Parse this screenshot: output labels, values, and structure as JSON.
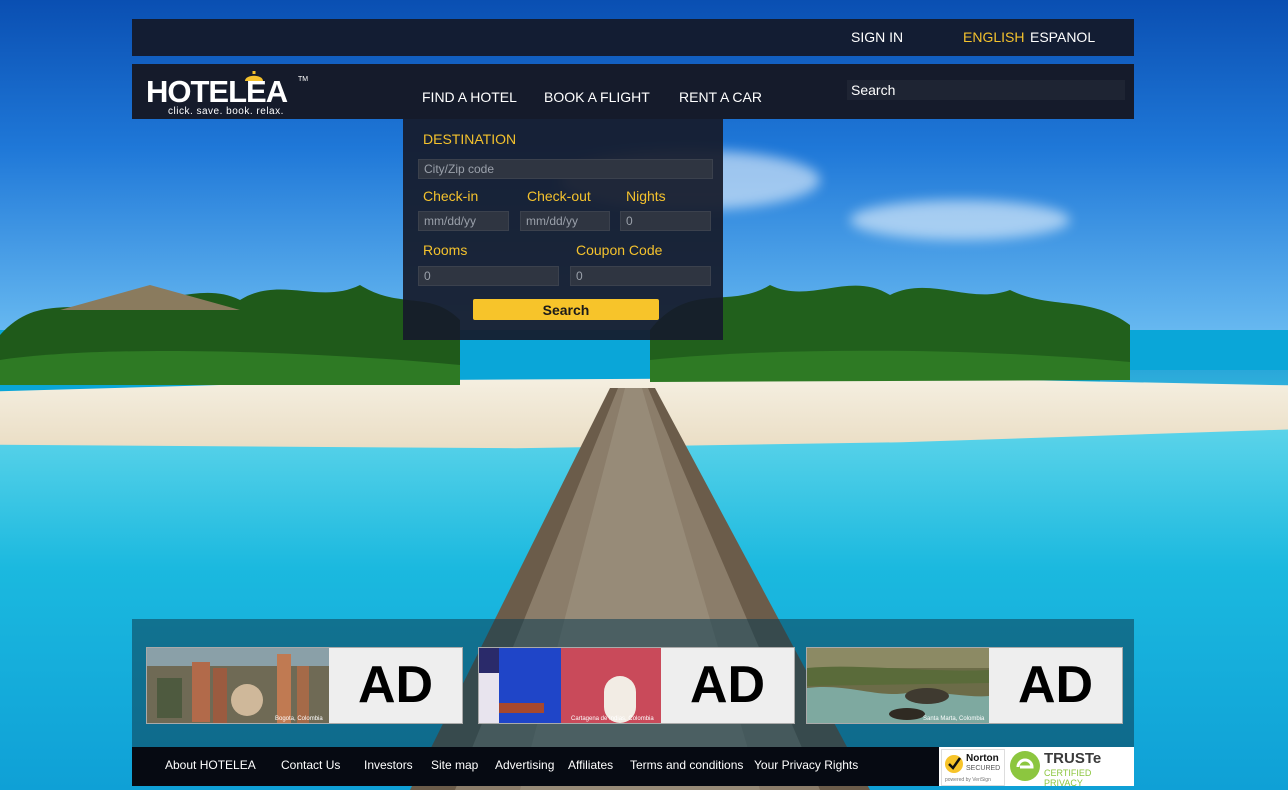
{
  "topbar": {
    "sign_in": "SIGN IN",
    "lang_english": "ENGLISH",
    "lang_espanol": "ESPANOL"
  },
  "logo": {
    "wordmark": "HOTELEA",
    "trademark": "TM",
    "tagline": "click. save. book. relax."
  },
  "nav": {
    "items": [
      {
        "label": "FIND A HOTEL"
      },
      {
        "label": "BOOK A FLIGHT"
      },
      {
        "label": "RENT A CAR"
      }
    ],
    "search_value": "Search"
  },
  "booking": {
    "destination_label": "DESTINATION",
    "destination_placeholder": "City/Zip code",
    "checkin_label": "Check-in",
    "checkin_placeholder": "mm/dd/yy",
    "checkout_label": "Check-out",
    "checkout_placeholder": "mm/dd/yy",
    "nights_label": "Nights",
    "nights_value": "0",
    "rooms_label": "Rooms",
    "rooms_value": "0",
    "coupon_label": "Coupon Code",
    "coupon_value": "0",
    "search_button": "Search"
  },
  "ads": [
    {
      "label": "AD",
      "caption": "Bogota, Colombia"
    },
    {
      "label": "AD",
      "caption": "Cartagena de Indias, Colombia"
    },
    {
      "label": "AD",
      "caption": "Santa Marta, Colombia"
    }
  ],
  "footer": {
    "links": [
      "About HOTELEA",
      "Contact Us",
      "Investors",
      "Site map",
      "Advertising",
      "Affiliates",
      "Terms and conditions",
      "Your Privacy Rights"
    ],
    "norton_title": "Norton",
    "norton_sub": "SECURED",
    "norton_powered": "powered by VeriSign",
    "truste_title": "TRUSTe",
    "truste_sub": "CERTIFIED PRIVACY"
  },
  "colors": {
    "accent": "#f4c22d",
    "bar_dark": "#151b2b"
  }
}
